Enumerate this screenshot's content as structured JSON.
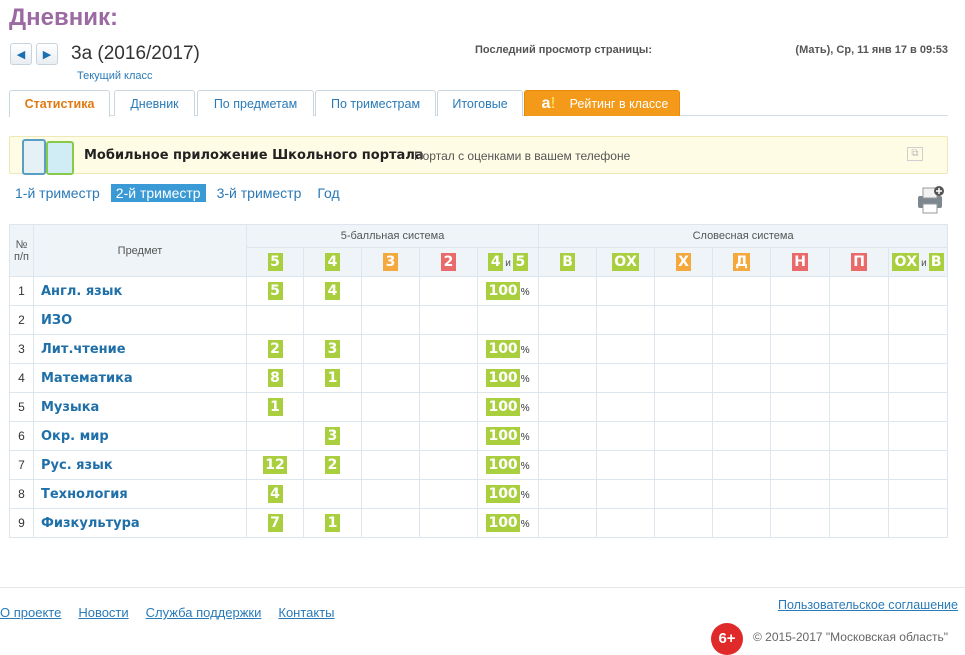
{
  "header": {
    "title": "Дневник:",
    "prev_icon": "◀",
    "next_icon": "▶",
    "class_name": "3а (2016/2017)",
    "class_subtitle": "Текущий класс",
    "last_view_label": "Последний просмотр страницы:",
    "last_view_value": "(Мать), Ср, 11 янв 17 в 09:53"
  },
  "tabs": [
    {
      "label": "Статистика",
      "active": true
    },
    {
      "label": "Дневник",
      "active": false
    },
    {
      "label": "По предметам",
      "active": false
    },
    {
      "label": "По триместрам",
      "active": false
    },
    {
      "label": "Итоговые",
      "active": false
    },
    {
      "label": "Рейтинг в классе",
      "active": false
    }
  ],
  "rating_logo": {
    "letter": "a",
    "mark": "!"
  },
  "banner": {
    "title": "Мобильное приложение Школьного портала",
    "subtitle": "Портал с оценками в вашем телефоне",
    "close_icon": "⧉"
  },
  "terms": [
    {
      "label": "1-й триместр",
      "active": false
    },
    {
      "label": "2-й триместр",
      "active": true
    },
    {
      "label": "3-й триместр",
      "active": false
    },
    {
      "label": "Год",
      "active": false
    }
  ],
  "table": {
    "col_num": "№ п/п",
    "col_subject": "Предмет",
    "group_five": "5-балльная система",
    "group_verbal": "Словесная система",
    "five_marks": [
      {
        "label": "5",
        "color": "green"
      },
      {
        "label": "4",
        "color": "green"
      },
      {
        "label": "3",
        "color": "orange"
      },
      {
        "label": "2",
        "color": "red"
      }
    ],
    "five_combo": {
      "a": "4",
      "and": "и",
      "b": "5"
    },
    "verbal_marks": [
      {
        "label": "В",
        "color": "green"
      },
      {
        "label": "ОХ",
        "color": "green"
      },
      {
        "label": "Х",
        "color": "orange"
      },
      {
        "label": "Д",
        "color": "orange"
      },
      {
        "label": "Н",
        "color": "red"
      },
      {
        "label": "П",
        "color": "red"
      }
    ],
    "verbal_combo": {
      "a": "ОХ",
      "and": "и",
      "b": "В"
    },
    "percent_sign": "%",
    "rows": [
      {
        "num": "1",
        "subject": "Англ. язык",
        "m5": "5",
        "m4": "4",
        "m3": "",
        "m2": "",
        "pct": "100"
      },
      {
        "num": "2",
        "subject": "ИЗО",
        "m5": "",
        "m4": "",
        "m3": "",
        "m2": "",
        "pct": ""
      },
      {
        "num": "3",
        "subject": "Лит.чтение",
        "m5": "2",
        "m4": "3",
        "m3": "",
        "m2": "",
        "pct": "100"
      },
      {
        "num": "4",
        "subject": "Математика",
        "m5": "8",
        "m4": "1",
        "m3": "",
        "m2": "",
        "pct": "100"
      },
      {
        "num": "5",
        "subject": "Музыка",
        "m5": "1",
        "m4": "",
        "m3": "",
        "m2": "",
        "pct": "100"
      },
      {
        "num": "6",
        "subject": "Окр. мир",
        "m5": "",
        "m4": "3",
        "m3": "",
        "m2": "",
        "pct": "100"
      },
      {
        "num": "7",
        "subject": "Рус. язык",
        "m5": "12",
        "m4": "2",
        "m3": "",
        "m2": "",
        "pct": "100"
      },
      {
        "num": "8",
        "subject": "Технология",
        "m5": "4",
        "m4": "",
        "m3": "",
        "m2": "",
        "pct": "100"
      },
      {
        "num": "9",
        "subject": "Физкультура",
        "m5": "7",
        "m4": "1",
        "m3": "",
        "m2": "",
        "pct": "100"
      }
    ]
  },
  "footer": {
    "links": [
      "О проекте",
      "Новости",
      "Служба поддержки",
      "Контакты"
    ],
    "agreement": "Пользовательское соглашение",
    "age": "6+",
    "copyright": "© 2015-2017 \"Московская область\""
  },
  "colors": {
    "green": "#a9cf3e",
    "orange": "#f5a83c",
    "red": "#ea6a6a",
    "accent": "#2a7ab8",
    "title": "#9b6aa3"
  }
}
